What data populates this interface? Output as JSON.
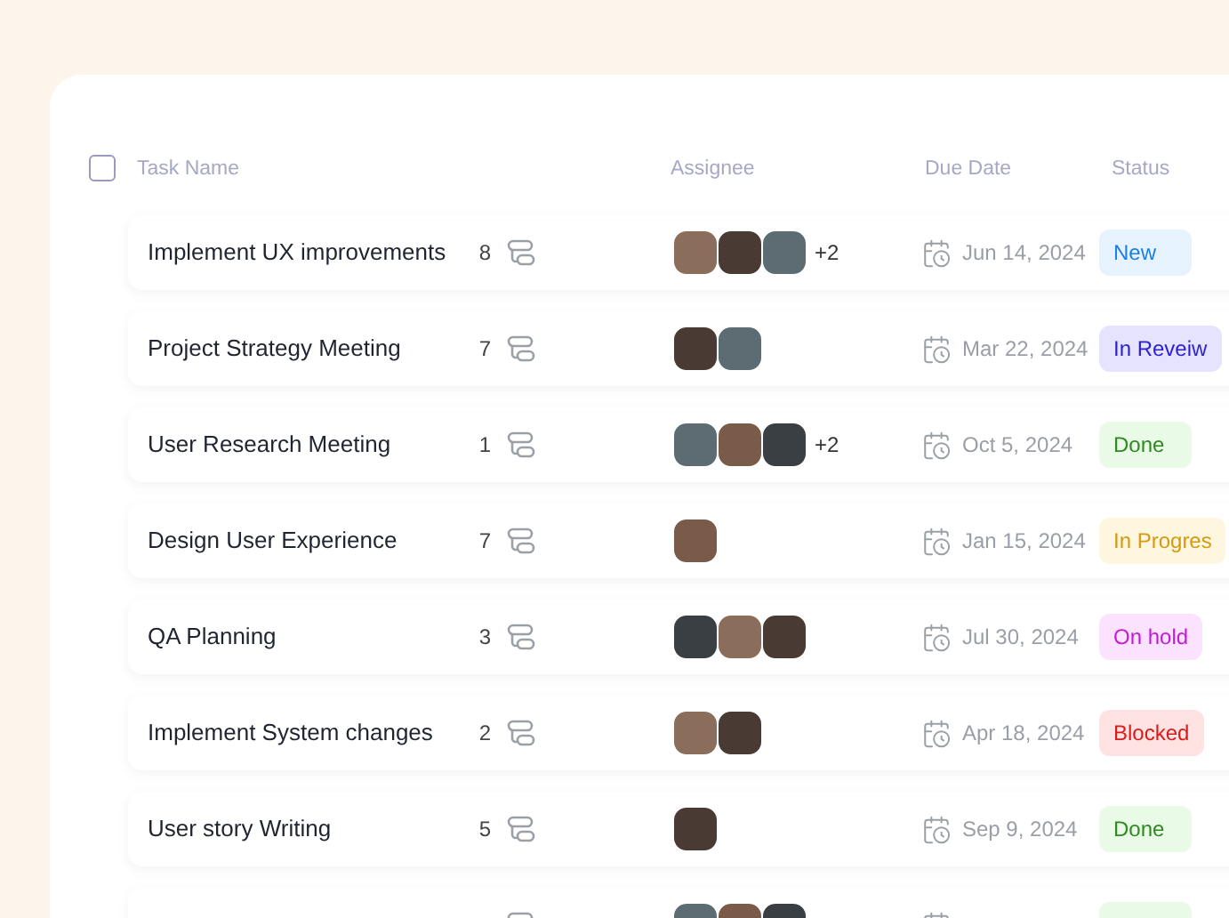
{
  "header": {
    "checkbox": {
      "checked": false
    },
    "columns": [
      "Task Name",
      "Assignee",
      "Due Date",
      "Status"
    ]
  },
  "rows": [
    {
      "name": "Implement UX improvements",
      "subtasks": "8",
      "avatars": [
        {
          "kind": "photo"
        },
        {
          "kind": "photo"
        },
        {
          "kind": "photo"
        }
      ],
      "more": "+2",
      "due": "Jun 14, 2024",
      "status": {
        "kind": "new",
        "label": "New"
      }
    },
    {
      "name": "Project Strategy Meeting",
      "subtasks": "7",
      "avatars": [
        {
          "kind": "photo"
        },
        {
          "kind": "photo"
        }
      ],
      "due": "Mar 22, 2024",
      "status": {
        "kind": "review",
        "label": "In Reveiw"
      }
    },
    {
      "name": "User Research Meeting",
      "subtasks": "1",
      "avatars": [
        {
          "kind": "photo"
        },
        {
          "kind": "photo"
        },
        {
          "kind": "photo"
        }
      ],
      "more": "+2",
      "due": "Oct 5, 2024",
      "status": {
        "kind": "done",
        "label": "Done"
      }
    },
    {
      "name": "Design User Experience",
      "subtasks": "7",
      "avatars": [
        {
          "kind": "photo"
        }
      ],
      "due": "Jan 15, 2024",
      "status": {
        "kind": "progress",
        "label": "In Progres"
      }
    },
    {
      "name": "QA Planning",
      "subtasks": "3",
      "avatars": [
        {
          "kind": "photo"
        },
        {
          "kind": "photo"
        },
        {
          "kind": "photo"
        }
      ],
      "due": "Jul 30, 2024",
      "status": {
        "kind": "hold",
        "label": "On hold"
      }
    },
    {
      "name": "Implement System changes",
      "subtasks": "2",
      "avatars": [
        {
          "kind": "photo"
        },
        {
          "kind": "photo"
        }
      ],
      "due": "Apr 18, 2024",
      "status": {
        "kind": "blocked",
        "label": "Blocked"
      }
    },
    {
      "name": "User story Writing",
      "subtasks": "5",
      "avatars": [
        {
          "kind": "photo"
        }
      ],
      "due": "Sep 9, 2024",
      "status": {
        "kind": "done",
        "label": "Done"
      }
    },
    {
      "avatars": [
        {
          "kind": "photo"
        },
        {
          "kind": "photo"
        },
        {
          "kind": "photo"
        }
      ],
      "status": {
        "kind": "done"
      }
    }
  ]
}
